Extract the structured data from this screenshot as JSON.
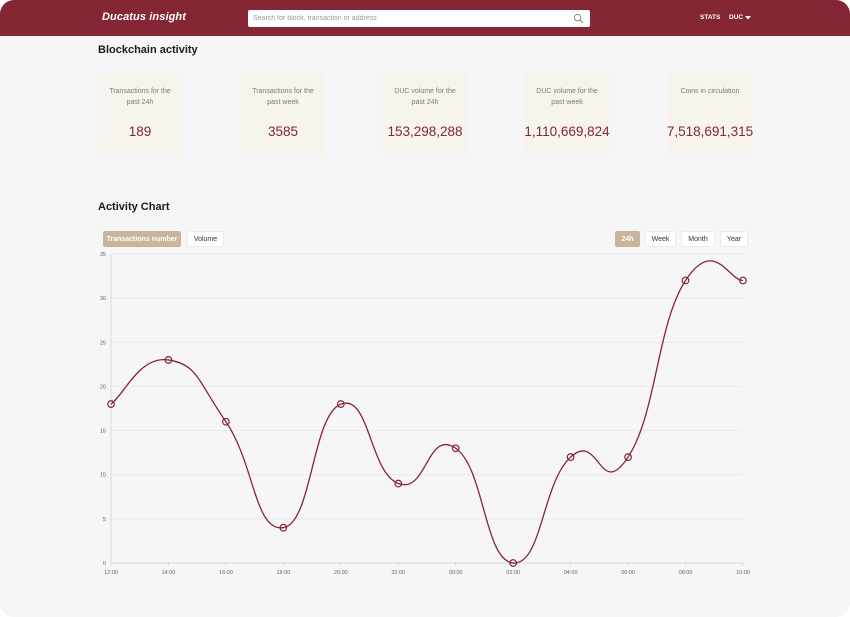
{
  "header": {
    "logo": "Ducatus insight",
    "search_placeholder": "Search for block, transaction or address",
    "stats_label": "STATS",
    "currency_label": "DUC"
  },
  "activity": {
    "title": "Blockchain activity",
    "cards": [
      {
        "label": "Transactions for the past 24h",
        "value": "189"
      },
      {
        "label": "Transactions for the past week",
        "value": "3585"
      },
      {
        "label": "DUC volume for the past 24h",
        "value": "153,298,288"
      },
      {
        "label": "DUC volume for the past week",
        "value": "1,110,669,824"
      },
      {
        "label": "Coins in circulation",
        "value": "7,518,691,315"
      }
    ]
  },
  "chart_section": {
    "title": "Activity Chart",
    "metric_tabs": [
      "Transactions number",
      "Volume"
    ],
    "active_metric": "Transactions number",
    "range_tabs": [
      "24h",
      "Week",
      "Month",
      "Year"
    ],
    "active_range": "24h"
  },
  "colors": {
    "brand": "#842634",
    "accent": "#c8b59a",
    "line": "#842634",
    "card_bg": "#f6f4ed"
  },
  "icons": {
    "search": "search-icon",
    "caret": "chevron-down-icon"
  },
  "chart_data": {
    "type": "line",
    "categories": [
      "12:00",
      "14:00",
      "16:00",
      "18:00",
      "20:00",
      "22:00",
      "00:00",
      "02:00",
      "04:00",
      "06:00",
      "08:00",
      "10:00"
    ],
    "values": [
      18,
      23,
      16,
      4,
      18,
      9,
      13,
      0,
      12,
      12,
      32,
      32
    ],
    "ylim": [
      0,
      35
    ],
    "yticks": [
      0,
      5,
      10,
      15,
      20,
      25,
      30,
      35
    ],
    "grid": true,
    "smooth": true,
    "markers": "hollow-circle",
    "title": "",
    "xlabel": "",
    "ylabel": ""
  }
}
